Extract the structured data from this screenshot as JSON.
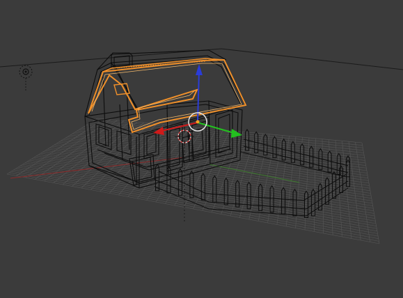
{
  "viewport": {
    "background": "#3b3b3b",
    "grid_color": "#5a5a5a",
    "grid_major_color": "#656565",
    "x_axis_color": "#8a2b2b",
    "y_axis_color": "#3d7a2d",
    "wire_color": "#0c0c0c",
    "selection_color": "#f0902a",
    "selection_inner_color": "#f5b96a"
  },
  "gizmo": {
    "x_color": "#d01a1a",
    "y_color": "#23c11f",
    "z_color": "#2a3cd8",
    "pivot_color": "#f59f25"
  },
  "lamp_icon": "sun-lamp-icon",
  "cursor_3d_icon": "3d-cursor-icon"
}
